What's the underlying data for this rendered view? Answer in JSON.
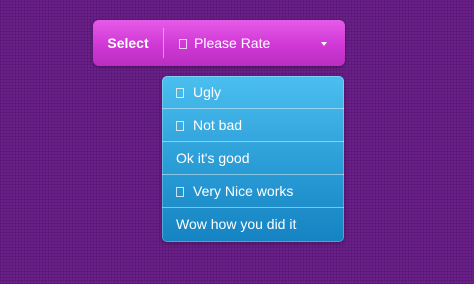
{
  "select": {
    "label": "Select",
    "value": "Please Rate"
  },
  "dropdown": {
    "items": [
      {
        "label": "Ugly",
        "has_icon": true
      },
      {
        "label": "Not bad",
        "has_icon": true
      },
      {
        "label": "Ok it's good",
        "has_icon": false
      },
      {
        "label": "Very Nice works",
        "has_icon": true
      },
      {
        "label": "Wow how you did it",
        "has_icon": false
      }
    ]
  },
  "colors": {
    "background": "#6b1f8a",
    "select_accent": "#cf38d5",
    "dropdown_accent": "#2a9cd6"
  }
}
